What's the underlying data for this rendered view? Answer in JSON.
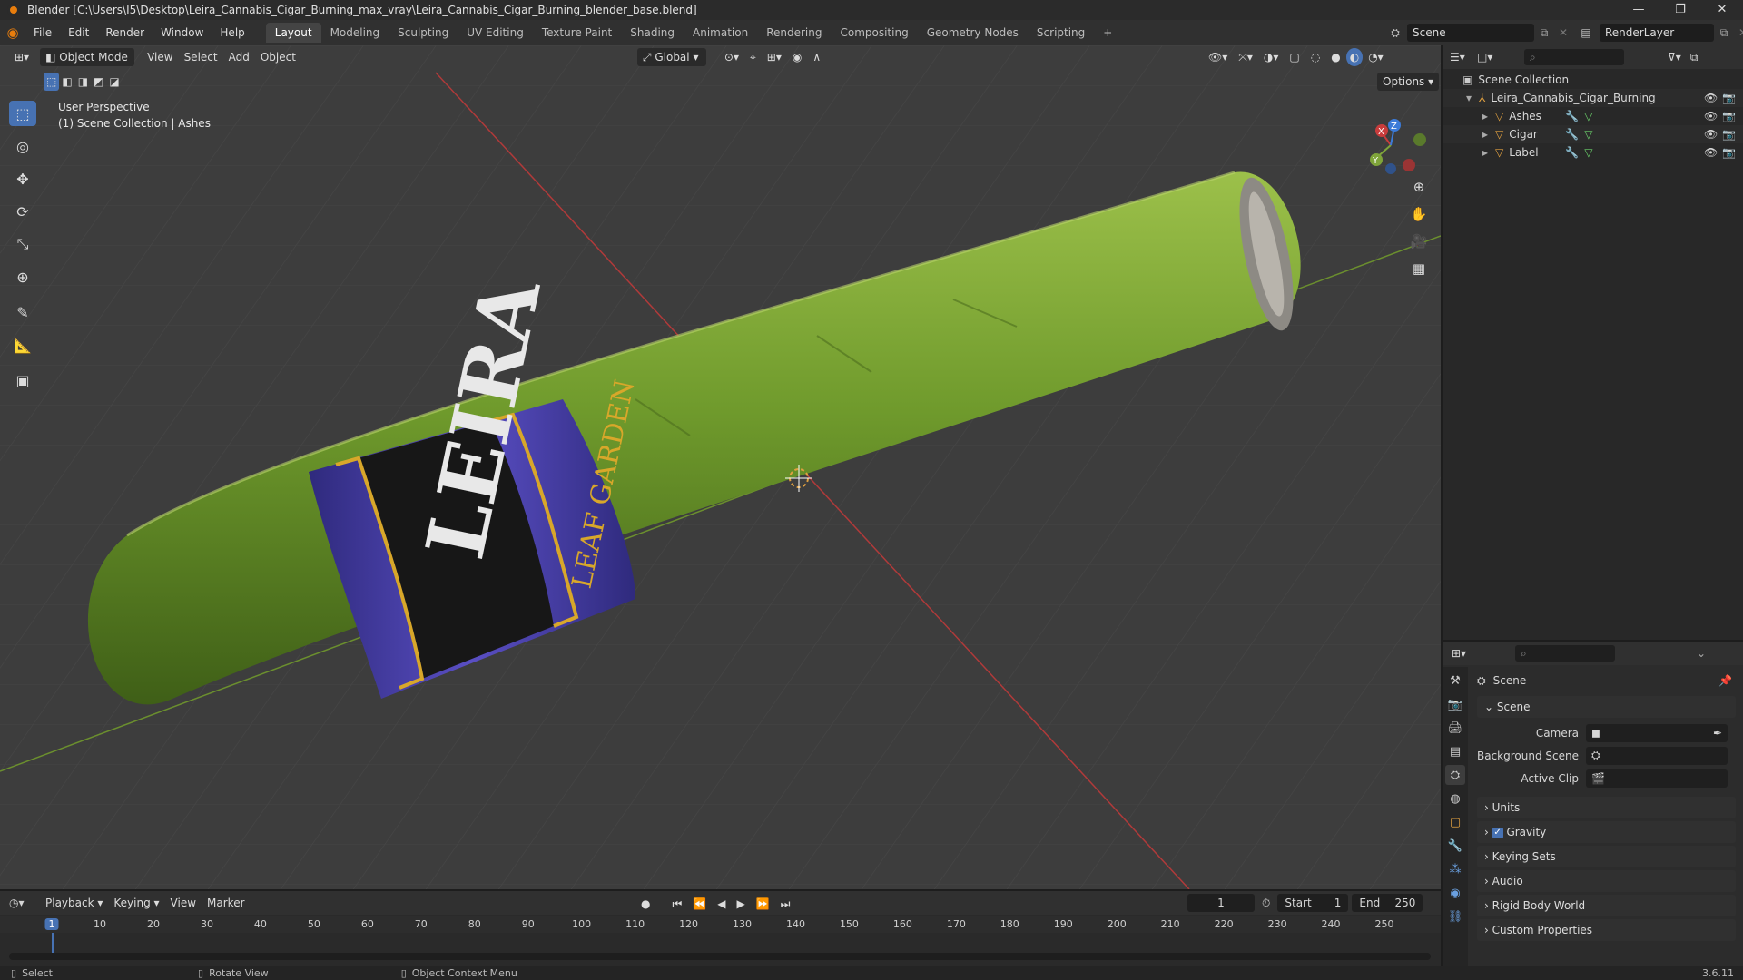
{
  "titlebar": {
    "title": "Blender [C:\\Users\\I5\\Desktop\\Leira_Cannabis_Cigar_Burning_max_vray\\Leira_Cannabis_Cigar_Burning_blender_base.blend]",
    "minimize": "—",
    "maximize": "❐",
    "close": "✕"
  },
  "menu": [
    "File",
    "Edit",
    "Render",
    "Window",
    "Help"
  ],
  "workspaces": [
    {
      "label": "Layout",
      "active": true
    },
    {
      "label": "Modeling"
    },
    {
      "label": "Sculpting"
    },
    {
      "label": "UV Editing"
    },
    {
      "label": "Texture Paint"
    },
    {
      "label": "Shading"
    },
    {
      "label": "Animation"
    },
    {
      "label": "Rendering"
    },
    {
      "label": "Compositing"
    },
    {
      "label": "Geometry Nodes"
    },
    {
      "label": "Scripting"
    }
  ],
  "add_workspace": "+",
  "scene": {
    "name": "Scene",
    "layer": "RenderLayer"
  },
  "viewport": {
    "mode": "Object Mode",
    "menus": [
      "View",
      "Select",
      "Add",
      "Object"
    ],
    "orientation": "Global",
    "options_label": "Options",
    "overlay_line1": "User Perspective",
    "overlay_line2": "(1) Scene Collection | Ashes",
    "label_text_main": "LEIRA",
    "label_text_side": "LEAF GARDEN",
    "gizmo": {
      "x": "X",
      "y": "Y",
      "z": "Z"
    }
  },
  "outliner": {
    "root": "Scene Collection",
    "collection": "Leira_Cannabis_Cigar_Burning",
    "objects": [
      "Ashes",
      "Cigar",
      "Label"
    ]
  },
  "properties": {
    "context": "Scene",
    "panel": "Scene",
    "camera_label": "Camera",
    "background_label": "Background Scene",
    "clip_label": "Active Clip",
    "sections": [
      {
        "label": "Units"
      },
      {
        "label": "Gravity",
        "checkbox": true,
        "checked": true
      },
      {
        "label": "Keying Sets"
      },
      {
        "label": "Audio"
      },
      {
        "label": "Rigid Body World"
      },
      {
        "label": "Custom Properties"
      }
    ]
  },
  "timeline": {
    "menus": [
      "Playback",
      "Keying",
      "View",
      "Marker"
    ],
    "current_frame": "1",
    "start_label": "Start",
    "start": "1",
    "end_label": "End",
    "end": "250",
    "ticks": [
      "1",
      "10",
      "20",
      "30",
      "40",
      "50",
      "60",
      "70",
      "80",
      "90",
      "100",
      "110",
      "120",
      "130",
      "140",
      "150",
      "160",
      "170",
      "180",
      "190",
      "200",
      "210",
      "220",
      "230",
      "240",
      "250"
    ]
  },
  "status": {
    "select": "Select",
    "rotate": "Rotate View",
    "context_menu": "Object Context Menu",
    "version": "3.6.11"
  },
  "colors": {
    "accent": "#4772b3",
    "x_axis": "#c83c3c",
    "y_axis": "#7fa43a",
    "cigar_green": "#6f9a2c",
    "label_blue": "#4a3fa6",
    "gold": "#d8a72a"
  }
}
